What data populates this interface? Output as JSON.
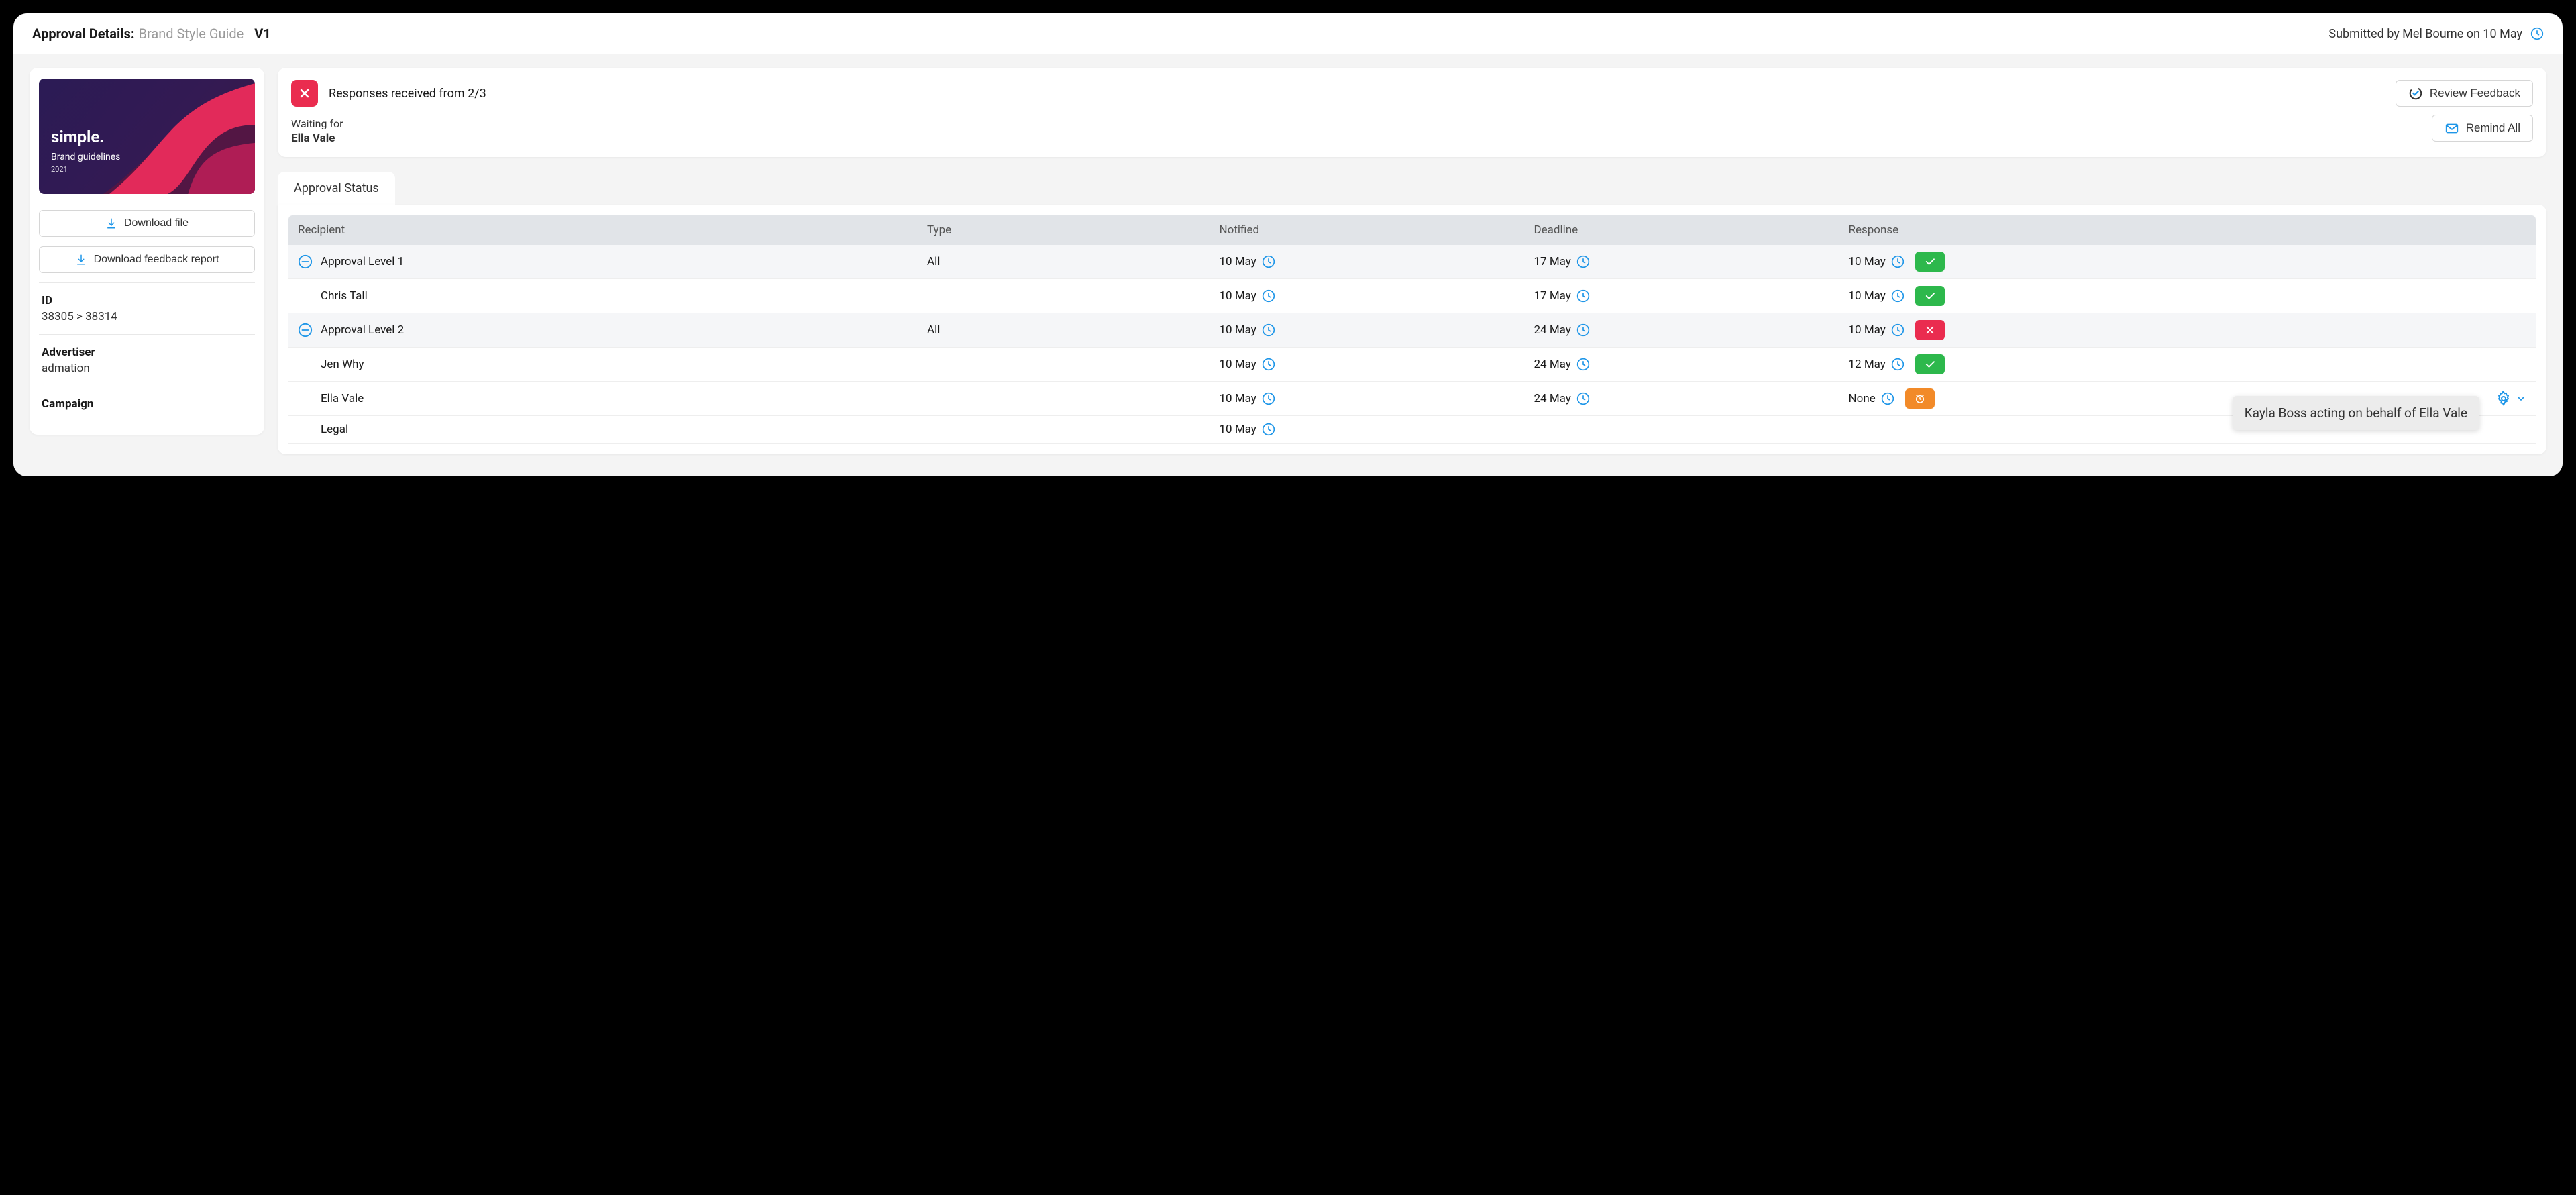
{
  "header": {
    "title_label": "Approval Details:",
    "title_doc": "Brand Style Guide",
    "version": "V1",
    "submitted_text": "Submitted by Mel Bourne on 10 May"
  },
  "sidebar": {
    "thumb": {
      "logo": "simple.",
      "line": "Brand guidelines",
      "year": "2021"
    },
    "download_file": "Download file",
    "download_report": "Download feedback report",
    "meta": [
      {
        "label": "ID",
        "value": "38305 > 38314"
      },
      {
        "label": "Advertiser",
        "value": "admation"
      },
      {
        "label": "Campaign",
        "value": ""
      }
    ]
  },
  "summary": {
    "responses": "Responses received from 2/3",
    "waiting_label": "Waiting for",
    "waiting_name": "Ella Vale",
    "review_feedback": "Review Feedback",
    "remind_all": "Remind All"
  },
  "table": {
    "tab_label": "Approval Status",
    "headers": {
      "recipient": "Recipient",
      "type": "Type",
      "notified": "Notified",
      "deadline": "Deadline",
      "response": "Response"
    },
    "rows": [
      {
        "kind": "level",
        "recipient": "Approval Level 1",
        "type": "All",
        "notified": "10 May",
        "deadline": "17 May",
        "response_date": "10 May",
        "response": "ok"
      },
      {
        "kind": "person",
        "recipient": "Chris Tall",
        "type": "",
        "notified": "10 May",
        "deadline": "17 May",
        "response_date": "10 May",
        "response": "ok"
      },
      {
        "kind": "level",
        "recipient": "Approval Level 2",
        "type": "All",
        "notified": "10 May",
        "deadline": "24 May",
        "response_date": "10 May",
        "response": "no"
      },
      {
        "kind": "person",
        "recipient": "Jen Why",
        "type": "",
        "notified": "10 May",
        "deadline": "24 May",
        "response_date": "12 May",
        "response": "ok"
      },
      {
        "kind": "person",
        "recipient": "Ella Vale",
        "type": "",
        "notified": "10 May",
        "deadline": "24 May",
        "response_date": "None",
        "response": "wt",
        "actions": true
      },
      {
        "kind": "person",
        "recipient": "Legal",
        "type": "",
        "notified": "10 May",
        "deadline": "",
        "response_date": "",
        "response": ""
      }
    ]
  },
  "tooltip": "Kayla Boss acting on behalf of Ella Vale"
}
